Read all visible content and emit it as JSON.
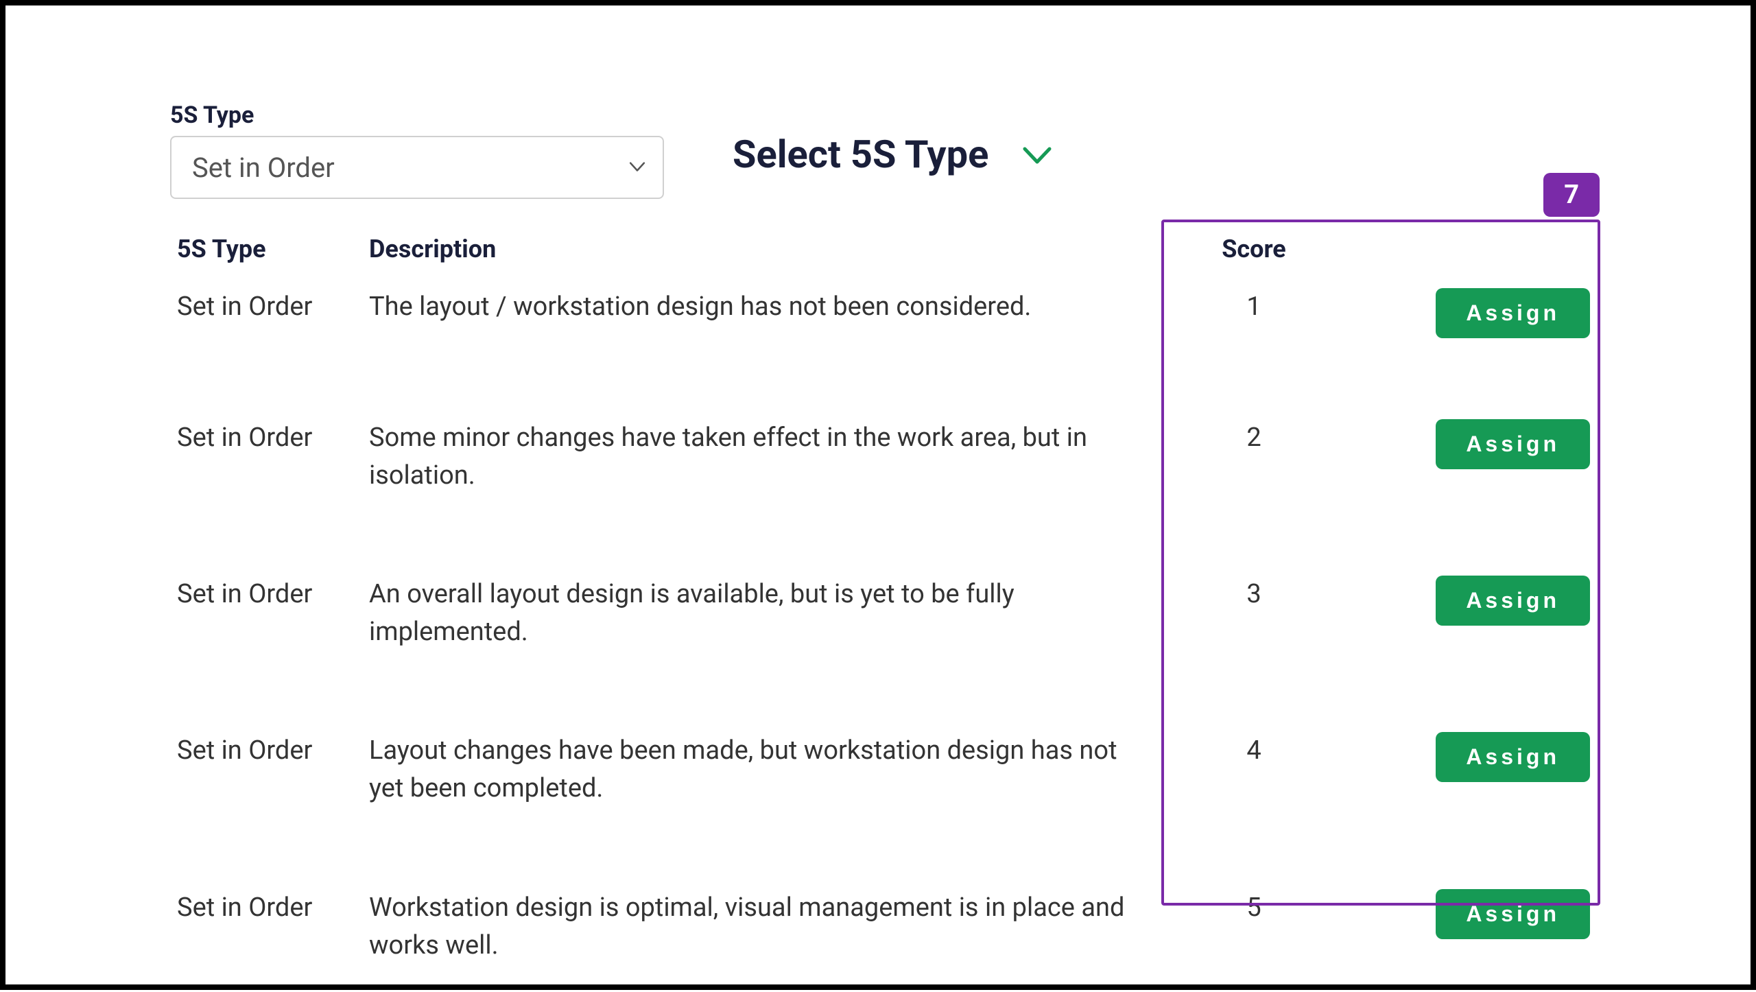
{
  "filter": {
    "label": "5S Type",
    "selected": "Set in Order"
  },
  "title": "Select 5S Type",
  "badge": "7",
  "table": {
    "headers": {
      "type": "5S Type",
      "description": "Description",
      "score": "Score"
    },
    "rows": [
      {
        "type": "Set in Order",
        "description": "The layout / workstation design has not been considered.",
        "score": "1",
        "action": "Assign"
      },
      {
        "type": "Set in Order",
        "description": "Some minor changes have taken effect in the work area, but in isolation.",
        "score": "2",
        "action": "Assign"
      },
      {
        "type": "Set in Order",
        "description": "An overall layout design is available, but is yet to be fully implemented.",
        "score": "3",
        "action": "Assign"
      },
      {
        "type": "Set in Order",
        "description": "Layout changes have been made, but workstation design has not yet been completed.",
        "score": "4",
        "action": "Assign"
      },
      {
        "type": "Set in Order",
        "description": "Workstation design is optimal, visual management is in place and works well.",
        "score": "5",
        "action": "Assign"
      }
    ]
  }
}
